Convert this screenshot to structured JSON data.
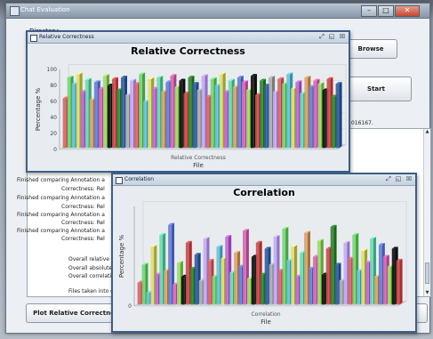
{
  "main_window": {
    "title": "Chat Evaluation",
    "directory_label": "Directory:",
    "buttons": {
      "browse": "Browse",
      "start": "Start",
      "plot_relative": "Plot Relative Correctne"
    },
    "partial_text": "016167."
  },
  "log": {
    "lines": [
      "Finished comparing Annotation a",
      "Correctness: Rel",
      "Finished comparing Annotation a",
      "Correctness: Rel",
      "Finished comparing Annotation a",
      "Correctness: Rel",
      "Finished comparing Annotation a",
      "Correctness: Rel",
      "Overall relative co",
      "Overall absolute c",
      "Overall correlation",
      "Files taken into c"
    ]
  },
  "relative_window": {
    "title": "Relative Correctness",
    "controls": {
      "restore": "⤢",
      "maximize": "◱",
      "close": "☒"
    }
  },
  "correlation_window": {
    "title": "Correlation",
    "controls": {
      "restore": "⤢",
      "maximize": "◱",
      "close": "☒"
    }
  },
  "chart_data": [
    {
      "type": "bar",
      "title": "Relative Correctness",
      "xlabel": "File",
      "ylabel": "Percentage %",
      "category": "Relative Correctness",
      "ylim": [
        0,
        100
      ],
      "yticks": [
        0,
        20,
        40,
        60,
        80,
        100
      ],
      "values": [
        62,
        88,
        80,
        92,
        70,
        85,
        60,
        82,
        74,
        90,
        78,
        86,
        72,
        88,
        66,
        84,
        80,
        92,
        58,
        86,
        74,
        88,
        70,
        82,
        90,
        76,
        84,
        68,
        88,
        80,
        72,
        90,
        64,
        86,
        78,
        92,
        70,
        84,
        76,
        88,
        82,
        72,
        90,
        66,
        84,
        78,
        88,
        70,
        86,
        80,
        92,
        74,
        82,
        68,
        88,
        76,
        84,
        80,
        72,
        86,
        64,
        80
      ],
      "colors": [
        "#e06666",
        "#6fdc6f",
        "#66c6e0",
        "#e0e066",
        "#c266e0",
        "#66e0b0",
        "#e0a366",
        "#6680e0",
        "#e066b8",
        "#99e066",
        "#111111",
        "#d64a4a",
        "#2e8b2e",
        "#2f5fa8",
        "#b0b0b0",
        "#c8a8ff"
      ]
    },
    {
      "type": "bar",
      "title": "Correlation",
      "xlabel": "File",
      "ylabel": "Percentage %",
      "category": "Correlation",
      "ylim": [
        0,
        100
      ],
      "yticks": [
        0
      ],
      "values": [
        22,
        40,
        12,
        58,
        30,
        70,
        34,
        80,
        20,
        42,
        28,
        62,
        36,
        50,
        24,
        66,
        44,
        28,
        58,
        46,
        68,
        32,
        52,
        38,
        74,
        26,
        48,
        62,
        30,
        56,
        40,
        68,
        34,
        76,
        44,
        58,
        28,
        52,
        72,
        36,
        48,
        64,
        30,
        56,
        78,
        40,
        24,
        62,
        46,
        70,
        34,
        54,
        42,
        66,
        28,
        60,
        48,
        38,
        56,
        44
      ],
      "colors": [
        "#e06666",
        "#6fdc6f",
        "#66c6e0",
        "#e0e066",
        "#c266e0",
        "#66e0b0",
        "#e0a366",
        "#6680e0",
        "#e066b8",
        "#99e066",
        "#111111",
        "#d64a4a",
        "#2e8b2e",
        "#2f5fa8",
        "#b0b0b0",
        "#c8a8ff"
      ]
    }
  ]
}
